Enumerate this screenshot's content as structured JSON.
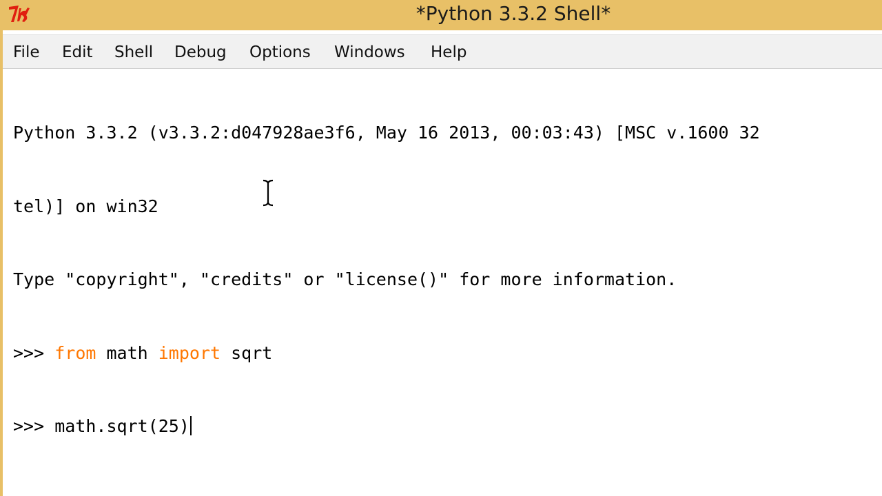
{
  "window": {
    "title": "*Python 3.3.2 Shell*",
    "app_icon": "tk-feather-icon"
  },
  "menu": {
    "items": [
      {
        "label": "File"
      },
      {
        "label": "Edit"
      },
      {
        "label": "Shell"
      },
      {
        "label": "Debug"
      },
      {
        "label": "Options"
      },
      {
        "label": "Windows"
      },
      {
        "label": "Help"
      }
    ]
  },
  "shell": {
    "banner_line1": "Python 3.3.2 (v3.3.2:d047928ae3f6, May 16 2013, 00:03:43) [MSC v.1600 32",
    "banner_line2": "tel)] on win32",
    "banner_line3": "Type \"copyright\", \"credits\" or \"license()\" for more information.",
    "prompt": ">>> ",
    "input1": {
      "kw_from": "from",
      "module": " math ",
      "kw_import": "import",
      "name": " sqrt"
    },
    "input2": "math.sqrt(25)"
  },
  "colors": {
    "titlebar": "#e8c067",
    "keyword": "#ff7700",
    "menubar": "#f1f1f1"
  },
  "cursor": "text-ibeam-cursor"
}
